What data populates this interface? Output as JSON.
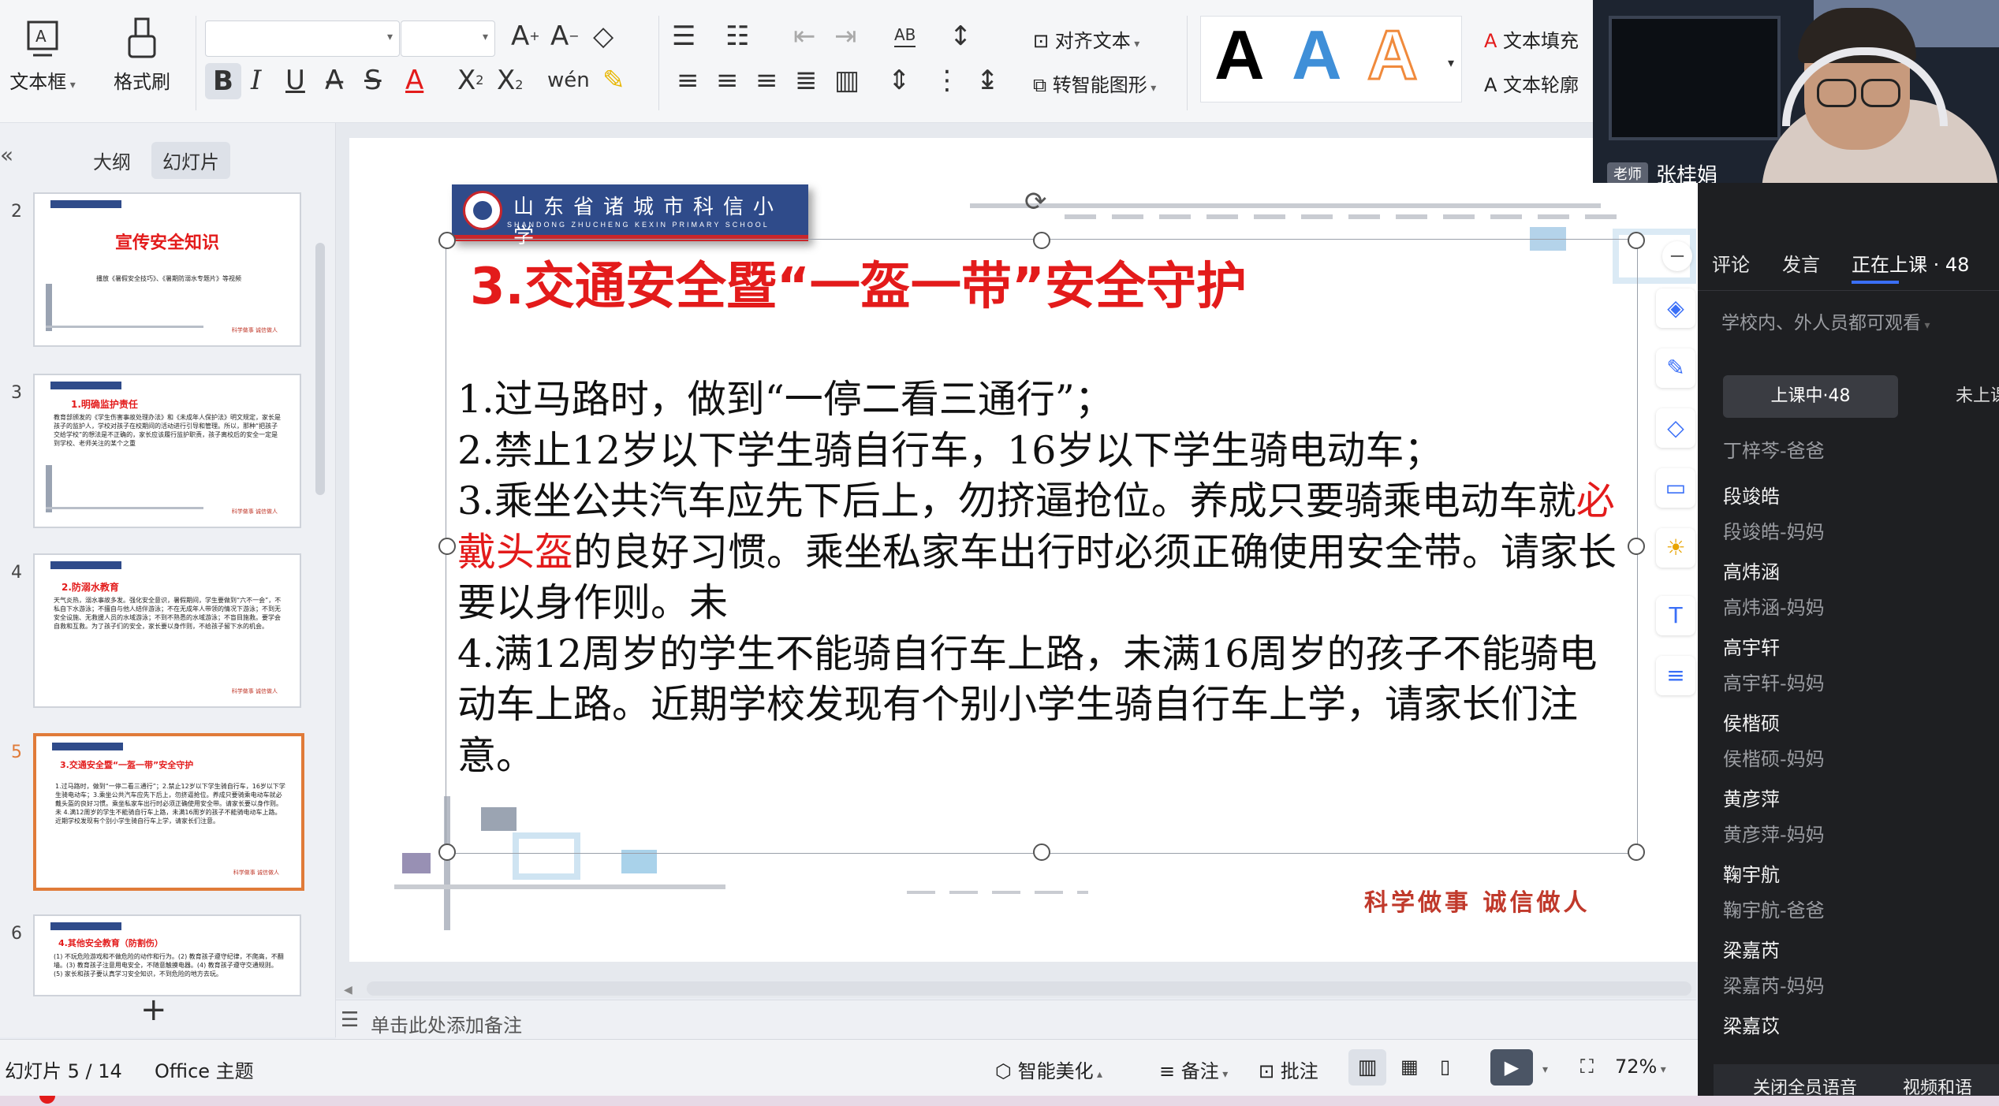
{
  "ribbon": {
    "textbox_label": "文本框",
    "format_painter_label": "格式刷",
    "align_text_label": "对齐文本",
    "smart_shape_label": "转智能图形",
    "text_fill_label": "文本填充",
    "text_outline_label": "文本轮廓",
    "phonetic_label": "wén",
    "ab_label": "AB",
    "style_a_label": "A"
  },
  "left_pane": {
    "tabs": [
      "大纲",
      "幻灯片"
    ],
    "add_label": "+",
    "thumbnails": [
      {
        "num": "2",
        "title": "宣传安全知识",
        "body": "播放《暑假安全技巧》、《暑期防溺水专题片》等视频",
        "foot": "科学做事 诚信做人"
      },
      {
        "num": "3",
        "title": "1.明确监护责任",
        "body": "教育部颁发的《学生伤害事故处理办法》和《未成年人保护法》明文规定，家长是孩子的监护人，学校对孩子在校期间的活动进行引导和管理。所以，那种“把孩子交给学校”的想法是不正确的，家长应该履行监护职责，孩子离校后的安全一定是到学校、老师关注的某个之重",
        "foot": "科学做事 诚信做人"
      },
      {
        "num": "4",
        "title": "2.防溺水教育",
        "body": "天气炎热，溺水事故多发。强化安全意识，暑假期间，学生要做到“六不一会”，不私自下水游泳；不擅自与他人结伴游泳；不在无成年人带领的情况下游泳；不到无安全设施、无救援人员的水域游泳；不到不熟悉的水域游泳；不盲目施救。要学会自救和互救。为了孩子们的安全，家长要以身作则，不给孩子留下水的机会。",
        "foot": "科学做事 诚信做人"
      },
      {
        "num": "5",
        "title": "3.交通安全暨“一盔一带”安全守护",
        "body": "1.过马路时，做到“一停二看三通行”；2.禁止12岁以下学生骑自行车，16岁以下学生骑电动车；3.乘坐公共汽车应先下后上，勿挤逼抢位。养成只要骑乘电动车就必戴头盔的良好习惯。乘坐私家车出行时必须正确使用安全带。请家长要以身作则。未 4.满12周岁的学生不能骑自行车上路，未满16周岁的孩子不能骑电动车上路。近期学校发现有个别小学生骑自行车上学，请家长们注意。",
        "foot": "科学做事 诚信做人"
      },
      {
        "num": "6",
        "title": "4.其他安全教育（防割伤）",
        "body": "(1) 不玩危险游戏和不做危险的动作和行为。(2) 教育孩子遵守纪律，不爬高，不翻墙。(3) 教育孩子注意用电安全，不随意触摸电器。(4) 教育孩子遵守交通规则。(5) 家长和孩子要认真学习安全知识，不到危险的地方去玩。",
        "foot": ""
      }
    ]
  },
  "slide": {
    "school_name": "山东省诸城市科信小学",
    "school_name_en": "SHANDONG ZHUCHENG KEXIN PRIMARY SCHOOL",
    "title": "3.交通安全暨“一盔一带”安全守护",
    "line1": "1.过马路时，做到“一停二看三通行”；",
    "line2": "2.禁止12岁以下学生骑自行车，16岁以下学生骑电动车；",
    "line3a": "3.乘坐公共汽车应先下后上，勿挤逼抢位。养成只要骑乘电动车就",
    "line3_red": "必戴头盔",
    "line3b": "的良好习惯。乘坐私家车出行时必须正确使用安全带。请家长要以身作则。未",
    "line4": "4.满12周岁的学生不能骑自行车上路，未满16周岁的孩子不能骑电动车上路。近期学校发现有个别小学生骑自行车上学，请家长们注意。",
    "motto": "科学做事 诚信做人"
  },
  "notes": {
    "placeholder": "单击此处添加备注"
  },
  "status": {
    "slide_info": "幻灯片 5 / 14",
    "theme": "Office 主题",
    "beautify": "智能美化",
    "notes_btn": "备注",
    "comment_btn": "批注",
    "zoom": "72%"
  },
  "live": {
    "teacher_tag": "老师",
    "teacher_name": "张桂娟",
    "tabs": [
      "评论",
      "发言",
      "正在上课 · 48"
    ],
    "visibility": "学校内、外人员都可观看",
    "subtabs": [
      "上课中·48",
      "未上课"
    ],
    "members": [
      {
        "name": "",
        "sub": "丁梓芩-爸爸"
      },
      {
        "name": "段竣皓",
        "sub": "段竣皓-妈妈"
      },
      {
        "name": "高炜涵",
        "sub": "高炜涵-妈妈"
      },
      {
        "name": "高宇轩",
        "sub": "高宇轩-妈妈"
      },
      {
        "name": "侯楷硕",
        "sub": "侯楷硕-妈妈"
      },
      {
        "name": "黄彦萍",
        "sub": "黄彦萍-妈妈"
      },
      {
        "name": "鞠宇航",
        "sub": "鞠宇航-爸爸"
      },
      {
        "name": "梁嘉芮",
        "sub": "梁嘉芮-妈妈"
      },
      {
        "name": "梁嘉苡",
        "sub": ""
      }
    ],
    "bottom_left": "关闭全员语音",
    "bottom_right": "视频和语"
  },
  "colors": {
    "accent_red": "#e31b1b",
    "selection_orange": "#e07b39",
    "school_blue": "#2f4b8a",
    "panel_bg": "#1e1f22",
    "tab_underline": "#3a6ff7"
  }
}
